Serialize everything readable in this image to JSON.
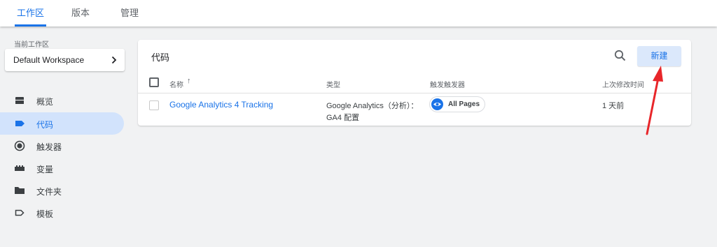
{
  "tabs": [
    {
      "label": "工作区"
    },
    {
      "label": "版本"
    },
    {
      "label": "管理"
    }
  ],
  "sidebar": {
    "workspace_label": "当前工作区",
    "workspace_name": "Default Workspace",
    "items": [
      {
        "label": "概览",
        "icon": "overview-icon"
      },
      {
        "label": "代码",
        "icon": "tag-icon"
      },
      {
        "label": "触发器",
        "icon": "trigger-icon"
      },
      {
        "label": "变量",
        "icon": "variable-icon"
      },
      {
        "label": "文件夹",
        "icon": "folder-icon"
      },
      {
        "label": "模板",
        "icon": "template-icon"
      }
    ]
  },
  "main": {
    "title": "代码",
    "new_button": "新建",
    "columns": {
      "name": "名称",
      "sort_indicator": "↑",
      "type": "类型",
      "trigger": "触发触发器",
      "last_edited": "上次修改时间"
    },
    "rows": [
      {
        "name": "Google Analytics 4 Tracking",
        "type_line1": "Google Analytics（分析）：",
        "type_line2": "GA4 配置",
        "trigger": "All Pages",
        "last_edited": "1 天前"
      }
    ]
  },
  "colors": {
    "accent": "#1a73e8",
    "nav_active_bg": "#d2e3fc",
    "new_button_bg": "#dbe8fb",
    "annotation_arrow": "#e8262a"
  }
}
